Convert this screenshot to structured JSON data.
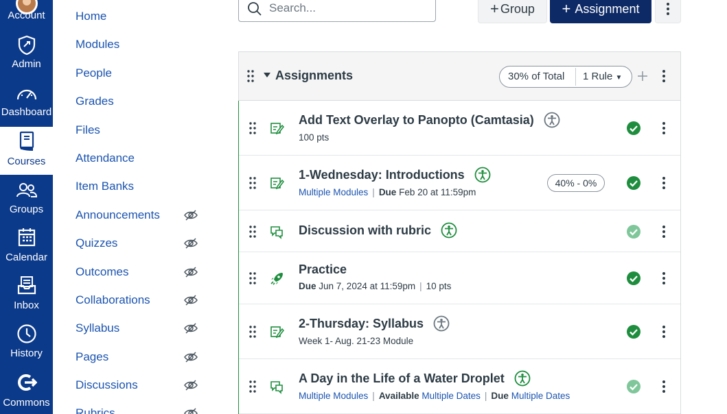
{
  "global_nav": [
    {
      "key": "account",
      "label": "Account",
      "icon": "account-avatar-icon"
    },
    {
      "key": "admin",
      "label": "Admin",
      "icon": "shield-icon"
    },
    {
      "key": "dashboard",
      "label": "Dashboard",
      "icon": "dashboard-gauge-icon"
    },
    {
      "key": "courses",
      "label": "Courses",
      "icon": "book-icon",
      "active": true
    },
    {
      "key": "groups",
      "label": "Groups",
      "icon": "groups-icon"
    },
    {
      "key": "calendar",
      "label": "Calendar",
      "icon": "calendar-icon"
    },
    {
      "key": "inbox",
      "label": "Inbox",
      "icon": "inbox-icon"
    },
    {
      "key": "history",
      "label": "History",
      "icon": "clock-icon"
    },
    {
      "key": "commons",
      "label": "Commons",
      "icon": "commons-arrow-icon"
    }
  ],
  "course_nav": [
    {
      "label": "Home",
      "hidden": false
    },
    {
      "label": "Modules",
      "hidden": false
    },
    {
      "label": "People",
      "hidden": false
    },
    {
      "label": "Grades",
      "hidden": false
    },
    {
      "label": "Files",
      "hidden": false
    },
    {
      "label": "Attendance",
      "hidden": false
    },
    {
      "label": "Item Banks",
      "hidden": false
    },
    {
      "label": "Announcements",
      "hidden": true
    },
    {
      "label": "Quizzes",
      "hidden": true
    },
    {
      "label": "Outcomes",
      "hidden": true
    },
    {
      "label": "Collaborations",
      "hidden": true
    },
    {
      "label": "Syllabus",
      "hidden": true
    },
    {
      "label": "Pages",
      "hidden": true
    },
    {
      "label": "Discussions",
      "hidden": true
    },
    {
      "label": "Rubrics",
      "hidden": true
    }
  ],
  "toolbar": {
    "search_placeholder": "Search...",
    "group_button": "Group",
    "assignment_button": "Assignment"
  },
  "group": {
    "title": "Assignments",
    "weight": "30% of Total",
    "rules": "1 Rule"
  },
  "rows": [
    {
      "type": "assignment-icon",
      "title": "Add Text Overlay to Panopto (Camtasia)",
      "accessibility": "gray",
      "meta": [
        {
          "text": "100 pts",
          "style": "plain"
        }
      ],
      "published": true,
      "score_range": ""
    },
    {
      "type": "assignment-icon",
      "title": "1-Wednesday: Introductions",
      "accessibility": "green",
      "meta": [
        {
          "text": "Multiple Modules",
          "style": "link"
        },
        {
          "text": "|",
          "style": "sep"
        },
        {
          "text": "Due",
          "style": "bold"
        },
        {
          "text": "Feb 20 at 11:59pm",
          "style": "plain"
        }
      ],
      "published": true,
      "score_range": "40% - 0%"
    },
    {
      "type": "discussion-icon",
      "title": "Discussion with rubric",
      "accessibility": "green",
      "meta": [],
      "published": false,
      "score_range": ""
    },
    {
      "type": "practice-rocket-icon",
      "title": "Practice",
      "accessibility": "",
      "meta": [
        {
          "text": "Due",
          "style": "bold"
        },
        {
          "text": "Jun 7, 2024 at 11:59pm",
          "style": "plain"
        },
        {
          "text": "|",
          "style": "sep"
        },
        {
          "text": "10 pts",
          "style": "plain"
        }
      ],
      "published": true,
      "score_range": ""
    },
    {
      "type": "assignment-icon",
      "title": "2-Thursday: Syllabus",
      "accessibility": "gray",
      "meta": [
        {
          "text": "Week 1- Aug. 21-23 Module",
          "style": "plain"
        }
      ],
      "published": true,
      "score_range": ""
    },
    {
      "type": "discussion-icon",
      "title": "A Day in the Life of a Water Droplet",
      "accessibility": "green",
      "meta": [
        {
          "text": "Multiple Modules",
          "style": "link"
        },
        {
          "text": "|",
          "style": "sep"
        },
        {
          "text": "Available",
          "style": "bold"
        },
        {
          "text": "Multiple Dates",
          "style": "link"
        },
        {
          "text": "|",
          "style": "sep"
        },
        {
          "text": "Due",
          "style": "bold"
        },
        {
          "text": "Multiple Dates",
          "style": "link"
        }
      ],
      "published": false,
      "score_range": ""
    }
  ],
  "colors": {
    "nav_bg": "#0c3a8a",
    "primary_button": "#0d2a66",
    "link": "#1b54b0",
    "published_green": "#1e8e3e",
    "unpublished_green": "#7fc79a"
  }
}
